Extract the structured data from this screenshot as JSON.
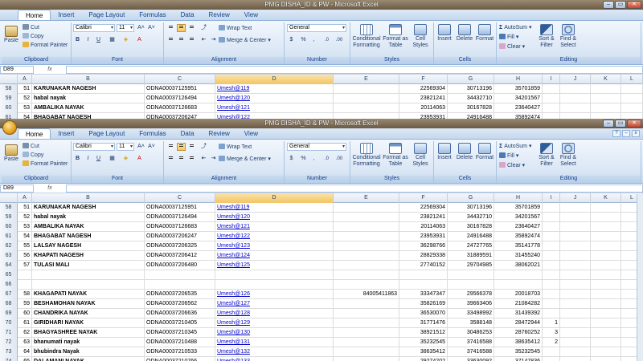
{
  "app": {
    "title": "PMG DISHA_ID & PW - Microsoft Excel",
    "win_buttons": [
      "–",
      "▭",
      "✕"
    ],
    "tabs": [
      "Home",
      "Insert",
      "Page Layout",
      "Formulas",
      "Data",
      "Review",
      "View"
    ]
  },
  "ribbon": {
    "clipboard": {
      "paste": "Paste",
      "cut": "Cut",
      "copy": "Copy",
      "format_painter": "Format Painter",
      "label": "Clipboard"
    },
    "font": {
      "name": "Calibri",
      "size": "11",
      "grow": "A˄",
      "shrink": "A˅",
      "bold": "B",
      "italic": "I",
      "underline": "U",
      "label": "Font"
    },
    "alignment": {
      "wrap": "Wrap Text",
      "merge": "Merge & Center",
      "label": "Alignment"
    },
    "number": {
      "format": "General",
      "currency": "$",
      "percent": "%",
      "comma": ",",
      "inc_dec": ".0",
      "dec_dec": ".00",
      "label": "Number"
    },
    "styles": {
      "conditional": "Conditional Formatting",
      "as_table": "Format as Table",
      "cell_styles": "Cell Styles",
      "label": "Styles"
    },
    "cells": {
      "insert": "Insert",
      "delete": "Delete",
      "format": "Format",
      "label": "Cells"
    },
    "editing": {
      "autosum": "AutoSum",
      "fill": "Fill",
      "clear": "Clear",
      "sort": "Sort & Filter",
      "find": "Find & Select",
      "label": "Editing"
    }
  },
  "formula_bar": {
    "name_box": "D89",
    "fx": "fx",
    "value": ""
  },
  "columns": [
    "A",
    "B",
    "C",
    "D",
    "E",
    "F",
    "G",
    "H",
    "I",
    "J",
    "K",
    "L"
  ],
  "back_rows": [
    {
      "n": "58",
      "a": "51",
      "b": "KARUNAKAR NAGESH",
      "c": "ODNA00037125951",
      "d": "Umesh@119",
      "e": "",
      "f": "22569304",
      "g": "30713196",
      "h": "35701859",
      "i": ""
    },
    {
      "n": "59",
      "a": "52",
      "b": "habal nayak",
      "c": "ODNA00037126494",
      "d": "Umesh@120",
      "e": "",
      "f": "23821241",
      "g": "34432710",
      "h": "34201567",
      "i": ""
    },
    {
      "n": "60",
      "a": "53",
      "b": "AMBALIKA NAYAK",
      "c": "ODNA00037126683",
      "d": "Umesh@121",
      "e": "",
      "f": "20114063",
      "g": "30167828",
      "h": "23640427",
      "i": ""
    },
    {
      "n": "61",
      "a": "54",
      "b": "BHAGABAT NAGESH",
      "c": "ODNA00037206247",
      "d": "Umesh@122",
      "e": "",
      "f": "23953931",
      "g": "24916488",
      "h": "35892474",
      "i": ""
    }
  ],
  "front_rows": [
    {
      "n": "58",
      "a": "51",
      "b": "KARUNAKAR NAGESH",
      "c": "ODNA00037125951",
      "d": "Umesh@119",
      "e": "",
      "f": "22569304",
      "g": "30713196",
      "h": "35701859",
      "i": ""
    },
    {
      "n": "59",
      "a": "52",
      "b": "habal nayak",
      "c": "ODNA00037126494",
      "d": "Umesh@120",
      "e": "",
      "f": "23821241",
      "g": "34432710",
      "h": "34201567",
      "i": ""
    },
    {
      "n": "60",
      "a": "53",
      "b": "AMBALIKA NAYAK",
      "c": "ODNA00037126683",
      "d": "Umesh@121",
      "e": "",
      "f": "20114063",
      "g": "30167828",
      "h": "23640427",
      "i": ""
    },
    {
      "n": "61",
      "a": "54",
      "b": "BHAGABAT NAGESH",
      "c": "ODNA00037206247",
      "d": "Umesh@122",
      "e": "",
      "f": "23953931",
      "g": "24916488",
      "h": "35892474",
      "i": ""
    },
    {
      "n": "62",
      "a": "55",
      "b": "LALSAY NAGESH",
      "c": "ODNA00037206325",
      "d": "Umesh@123",
      "e": "",
      "f": "36298766",
      "g": "24727765",
      "h": "35141778",
      "i": ""
    },
    {
      "n": "63",
      "a": "56",
      "b": "KHAPATI NAGESH",
      "c": "ODNA00037206412",
      "d": "Umesh@124",
      "e": "",
      "f": "28829338",
      "g": "31889591",
      "h": "31455240",
      "i": ""
    },
    {
      "n": "64",
      "a": "57",
      "b": "TULASI MALI",
      "c": "ODNA00037206480",
      "d": "Umesh@125",
      "e": "",
      "f": "27740152",
      "g": "29704985",
      "h": "38062021",
      "i": ""
    },
    {
      "n": "65",
      "a": "",
      "b": "",
      "c": "",
      "d": "",
      "e": "",
      "f": "",
      "g": "",
      "h": "",
      "i": ""
    },
    {
      "n": "66",
      "a": "",
      "b": "",
      "c": "",
      "d": "",
      "e": "",
      "f": "",
      "g": "",
      "h": "",
      "i": ""
    },
    {
      "n": "67",
      "a": "58",
      "b": "KHAGAPATI NAYAK",
      "c": "ODNA00037206535",
      "d": "Umesh@126",
      "e": "84005411863",
      "f": "33347347",
      "g": "29566378",
      "h": "20018703",
      "i": ""
    },
    {
      "n": "68",
      "a": "59",
      "b": "BESHAMOHAN NAYAK",
      "c": "ODNA00037206562",
      "d": "Umesh@127",
      "e": "",
      "f": "35826169",
      "g": "39663406",
      "h": "21084282",
      "i": ""
    },
    {
      "n": "69",
      "a": "60",
      "b": "CHANDRIKA NAYAK",
      "c": "ODNA00037206636",
      "d": "Umesh@128",
      "e": "",
      "f": "36530070",
      "g": "33498992",
      "h": "31439392",
      "i": ""
    },
    {
      "n": "70",
      "a": "61",
      "b": "GIRIDHARI NAYAK",
      "c": "ODNA00037210405",
      "d": "Umesh@129",
      "e": "",
      "f": "31771476",
      "g": "3588148",
      "h": "28472944",
      "i": "1"
    },
    {
      "n": "71",
      "a": "62",
      "b": "BHAGYASHREE NAYAK",
      "c": "ODNA00037210345",
      "d": "Umesh@130",
      "e": "",
      "f": "38921512",
      "g": "30486253",
      "h": "28760252",
      "i": "3"
    },
    {
      "n": "72",
      "a": "63",
      "b": "bhanumati nayak",
      "c": "ODNA00037210488",
      "d": "Umesh@131",
      "e": "",
      "f": "35232545",
      "g": "37416588",
      "h": "38635412",
      "i": "2"
    },
    {
      "n": "73",
      "a": "64",
      "b": "bhubindra Nayak",
      "c": "ODNA00037210533",
      "d": "Umesh@132",
      "e": "",
      "f": "38635412",
      "g": "37416588",
      "h": "35232545",
      "i": ""
    },
    {
      "n": "74",
      "a": "65",
      "b": "DALAMANI NAYAK",
      "c": "ODNA00037210766",
      "d": "Umesh@133",
      "e": "",
      "f": "29274202",
      "g": "33630092",
      "h": "37147836",
      "i": ""
    }
  ]
}
